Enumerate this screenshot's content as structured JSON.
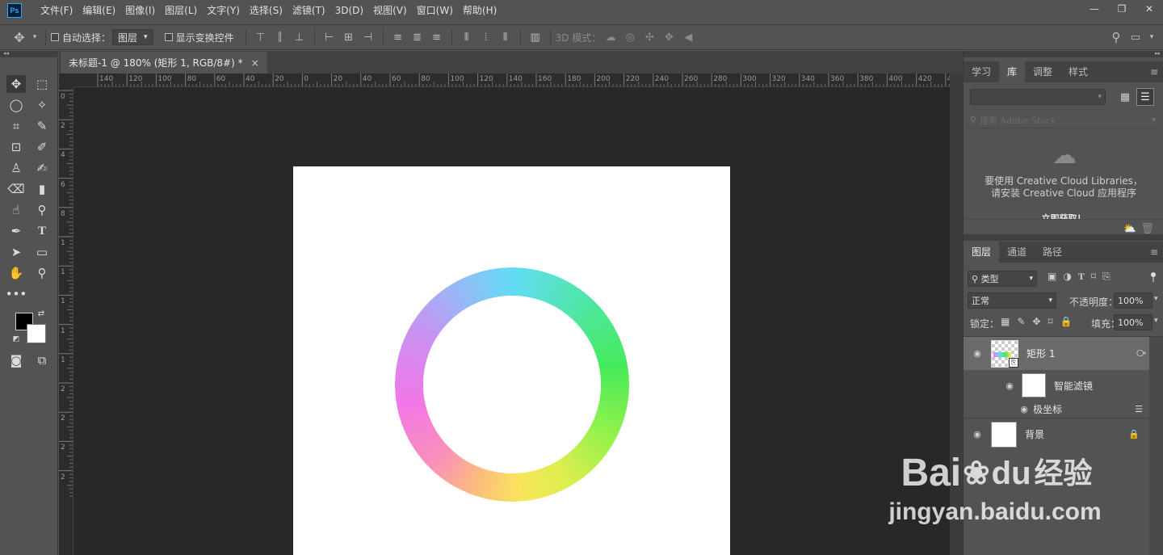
{
  "app": {
    "logo": "Ps"
  },
  "menu": [
    "文件(F)",
    "编辑(E)",
    "图像(I)",
    "图层(L)",
    "文字(Y)",
    "选择(S)",
    "滤镜(T)",
    "3D(D)",
    "视图(V)",
    "窗口(W)",
    "帮助(H)"
  ],
  "window_controls": {
    "minimize": "—",
    "restore": "❐",
    "close": "✕"
  },
  "options": {
    "auto_select_label": "自动选择：",
    "auto_select_target": "图层",
    "show_transform_label": "显示变换控件",
    "mode_3d_label": "3D 模式："
  },
  "document": {
    "tab_title": "未标题-1 @ 180% (矩形 1, RGB/8#) *",
    "close": "×"
  },
  "ruler_top_labels": [
    "140",
    "120",
    "100",
    "80",
    "60",
    "40",
    "20",
    "0",
    "20",
    "40",
    "60",
    "80",
    "100",
    "120",
    "140",
    "160",
    "180",
    "200",
    "220",
    "240",
    "260",
    "280",
    "300",
    "320",
    "340",
    "360",
    "380",
    "400",
    "420",
    "440"
  ],
  "ruler_left_labels": [
    "0",
    "2",
    "4",
    "6",
    "8",
    "1",
    "1",
    "1",
    "1",
    "1",
    "2",
    "2",
    "2",
    "2"
  ],
  "panels": {
    "top_tabs": [
      "学习",
      "库",
      "调整",
      "样式"
    ],
    "top_active": 1,
    "library": {
      "search_placeholder": "搜索 Adobe Stock",
      "message_line1": "要使用 Creative Cloud Libraries，",
      "message_line2": "请安装 Creative Cloud 应用程序",
      "message_line3": "立即获取！"
    },
    "layer_tabs": [
      "图层",
      "通道",
      "路径"
    ],
    "layer_active": 0,
    "filter_kind": "类型",
    "blend_mode": "正常",
    "opacity_label": "不透明度：",
    "opacity_value": "100%",
    "lock_label": "锁定：",
    "fill_label": "填充：",
    "fill_value": "100%",
    "layers": [
      {
        "name": "矩形 1"
      },
      {
        "name": "智能滤镜"
      },
      {
        "name": "极坐标"
      },
      {
        "name": "背景"
      }
    ]
  },
  "watermark": {
    "brand": "Bai",
    "brand2": "du",
    "suffix": "经验",
    "url": "jingyan.baidu.com"
  }
}
